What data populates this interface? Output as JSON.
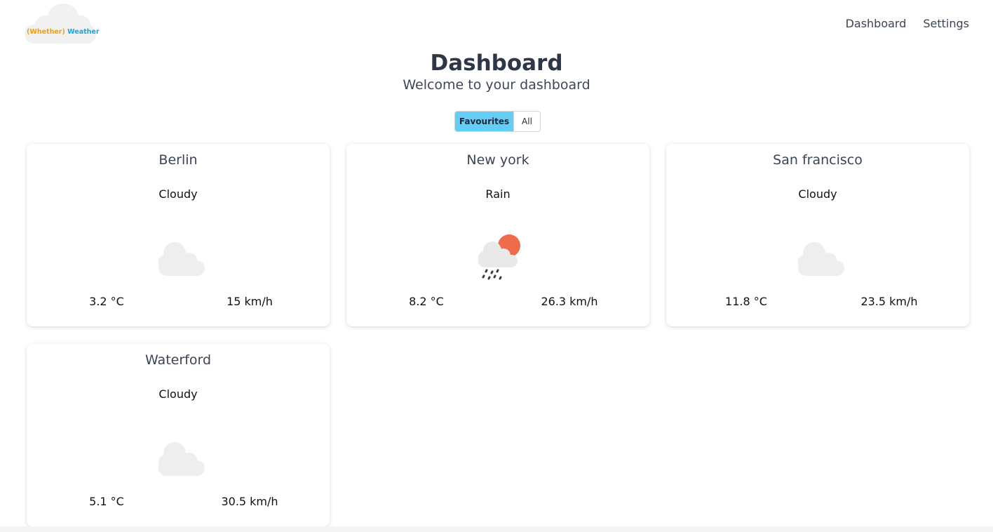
{
  "app": {
    "logo_word1": "(Whether)",
    "logo_word2": "Weather"
  },
  "nav": {
    "items": [
      {
        "label": "Dashboard"
      },
      {
        "label": "Settings"
      }
    ]
  },
  "header": {
    "title": "Dashboard",
    "subtitle": "Welcome to your dashboard"
  },
  "filter": {
    "options": [
      "Favourites",
      "All"
    ],
    "selected": "Favourites",
    "selected_color": "#63cdf6"
  },
  "cards": [
    {
      "city": "Berlin",
      "condition": "Cloudy",
      "temperature": "3.2 °C",
      "wind": "15 km/h",
      "icon": "cloud-icon"
    },
    {
      "city": "New york",
      "condition": "Rain",
      "temperature": "8.2 °C",
      "wind": "26.3 km/h",
      "icon": "sun-rain-cloud-icon"
    },
    {
      "city": "San francisco",
      "condition": "Cloudy",
      "temperature": "11.8 °C",
      "wind": "23.5 km/h",
      "icon": "cloud-icon"
    },
    {
      "city": "Waterford",
      "condition": "Cloudy",
      "temperature": "5.1 °C",
      "wind": "30.5 km/h",
      "icon": "cloud-icon"
    }
  ]
}
